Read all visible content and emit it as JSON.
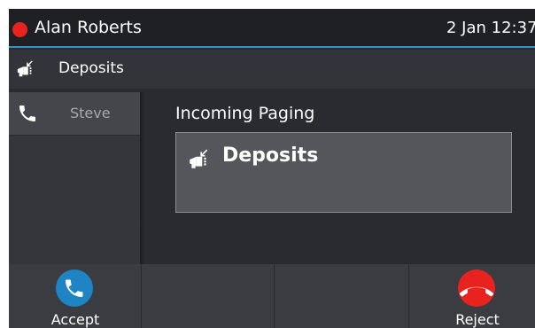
{
  "status_bar": {
    "user_name": "Alan Roberts",
    "datetime": "2 Jan 12:37",
    "presence_color": "#e8221f"
  },
  "sub_header": {
    "icon": "paging-icon",
    "title": "Deposits"
  },
  "call_list": {
    "items": [
      {
        "icon": "phone-icon",
        "label": "Steve"
      }
    ]
  },
  "main": {
    "title": "Incoming Paging",
    "card": {
      "icon": "paging-icon",
      "title": "Deposits"
    }
  },
  "softkeys": [
    {
      "label": "Accept",
      "icon": "phone-icon",
      "color": "#1e84c4"
    },
    {
      "label": "",
      "icon": ""
    },
    {
      "label": "",
      "icon": ""
    },
    {
      "label": "Reject",
      "icon": "hang-up-icon",
      "color": "#e8221f"
    }
  ]
}
